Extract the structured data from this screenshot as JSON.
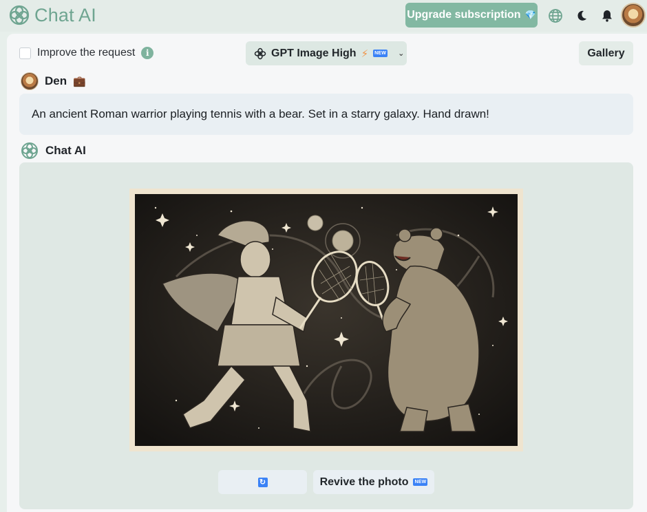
{
  "header": {
    "brand_name": "Chat AI",
    "upgrade_label": "Upgrade subscription",
    "upgrade_icon": "💎",
    "icons": [
      "globe-icon",
      "moon-icon",
      "bell-icon",
      "user-avatar"
    ]
  },
  "toolbar": {
    "improve_label": "Improve the request",
    "info_glyph": "i",
    "model_label": "GPT Image High",
    "model_badge": "NEW",
    "gallery_label": "Gallery"
  },
  "conversation": {
    "user_name": "Den",
    "user_emoji": "💼",
    "prompt": "An ancient Roman warrior playing tennis with a bear. Set in a starry galaxy. Hand drawn!",
    "ai_name": "Chat AI"
  },
  "actions": {
    "regenerate_icon": "🔄",
    "revive_label": "Revive the photo",
    "revive_badge": "NEW"
  },
  "colors": {
    "brand": "#6fa591",
    "upgrade_bg": "#82b8a2",
    "accent_blue": "#3b82f6",
    "answer_bg": "#dfe8e4"
  }
}
